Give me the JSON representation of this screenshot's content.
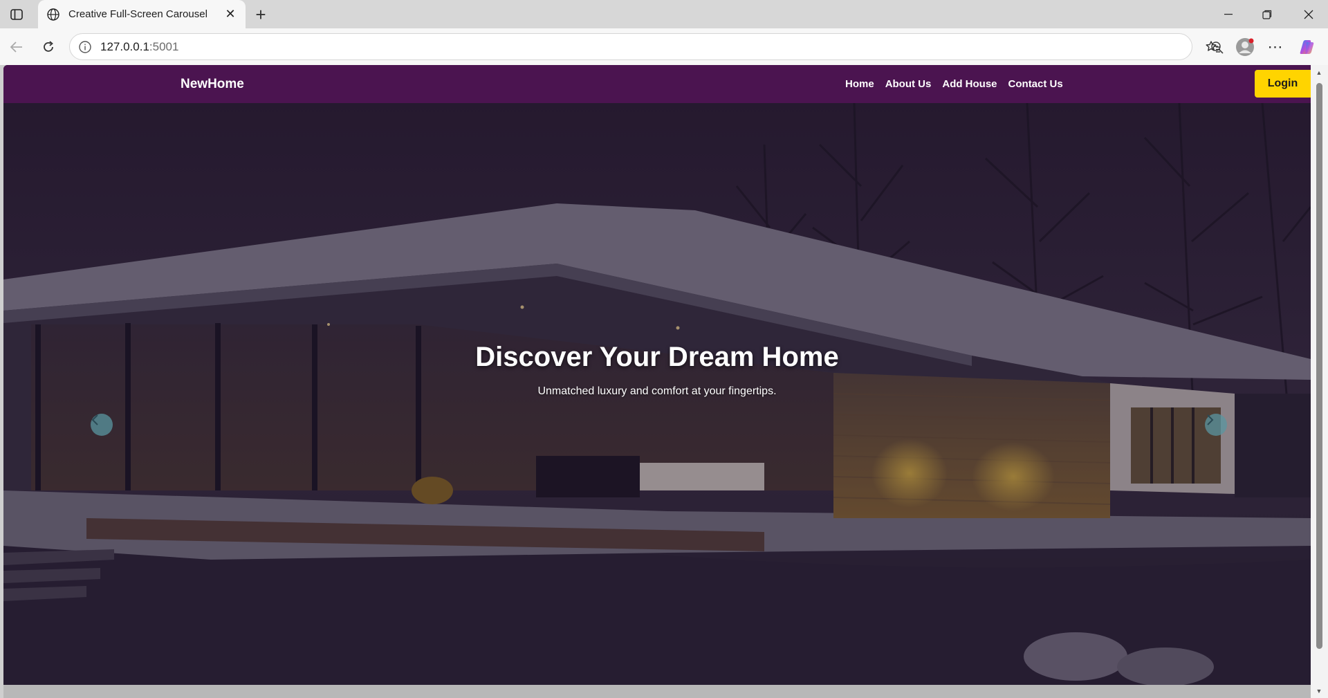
{
  "browser": {
    "tab_title": "Creative Full-Screen Carousel",
    "url_host": "127.0.0.1",
    "url_port": ":5001"
  },
  "navbar": {
    "brand": "NewHome",
    "links": [
      "Home",
      "About Us",
      "Add House",
      "Contact Us"
    ],
    "login_label": "Login",
    "background_color": "#4b1450",
    "login_color": "#ffd400"
  },
  "hero": {
    "title": "Discover Your Dream Home",
    "subtitle": "Unmatched luxury and comfort at your fingertips."
  },
  "icons": {
    "sidebar_toggle": "sidebar-icon",
    "tab_icon": "globe-icon",
    "tab_close": "close-icon",
    "new_tab": "plus-icon",
    "back": "arrow-left-icon",
    "reload": "reload-icon",
    "site_info": "info-icon",
    "zoom": "zoom-out-icon",
    "bookmark": "star-icon",
    "favorites": "favorites-icon",
    "profile": "profile-icon",
    "more": "more-icon",
    "copilot": "copilot-icon",
    "carousel_prev": "chevron-left-icon",
    "carousel_next": "chevron-right-icon"
  }
}
